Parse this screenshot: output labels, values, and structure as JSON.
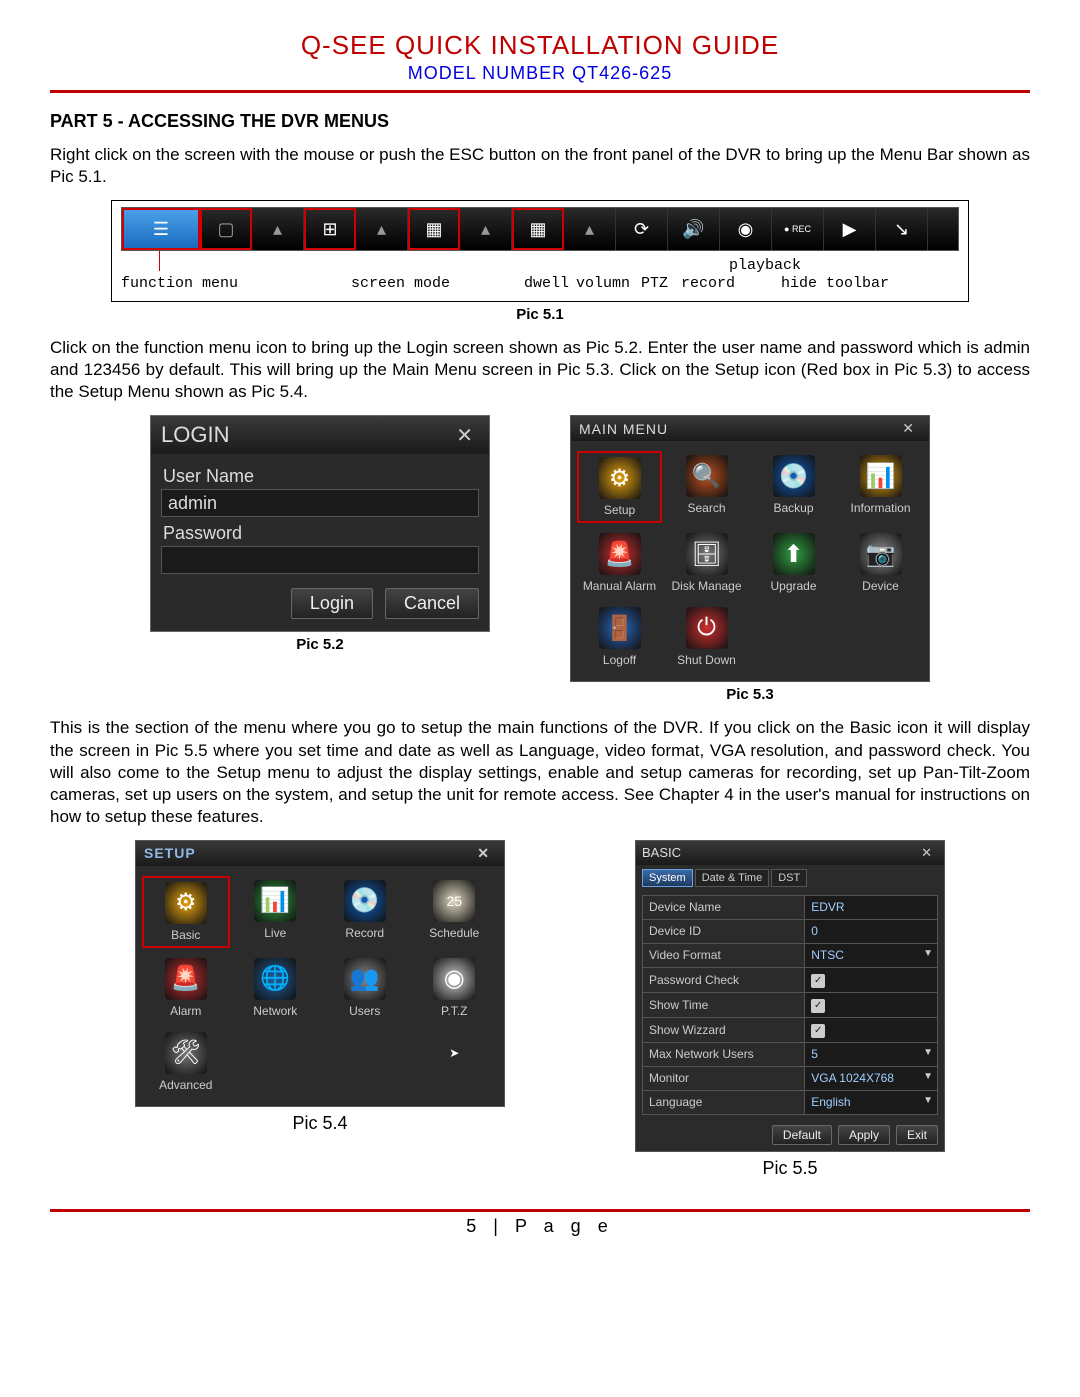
{
  "doc": {
    "title": "Q-SEE QUICK INSTALLATION GUIDE",
    "model": "MODEL NUMBER QT426-625",
    "part": "PART 5 - ACCESSING THE DVR MENUS",
    "para1": "Right click on the screen with the mouse or push the ESC button on the front panel of the DVR to bring up the Menu Bar shown as Pic 5.1.",
    "para2": "Click on the function menu icon to bring up the Login screen shown as Pic 5.2. Enter the user name and password which is admin and 123456 by default. This will bring up the Main Menu screen in Pic 5.3. Click on the Setup icon (Red box in Pic 5.3) to access the Setup Menu shown as Pic 5.4.",
    "para3": "This is the section of the menu where you go to setup the main functions of the DVR. If you click on the Basic icon it will display the screen in Pic 5.5 where you set time and date as well as Language, video format, VGA resolution, and password check. You will also come to the Setup menu to adjust the display settings, enable and setup cameras for recording, set up Pan-Tilt-Zoom cameras, set up users on the system, and setup the unit for remote access. See Chapter 4 in the user's manual for instructions on how to setup these features.",
    "page": "5 | P a g e"
  },
  "pic51": {
    "caption": "Pic 5.1",
    "labels": {
      "function_menu": "function menu",
      "screen_mode": "screen mode",
      "dwell": "dwell",
      "volumn": "volumn",
      "ptz": "PTZ",
      "record": "record",
      "playback": "playback",
      "hide": "hide toolbar"
    },
    "rec": "REC"
  },
  "pic52": {
    "caption": "Pic 5.2",
    "title": "LOGIN",
    "user_label": "User Name",
    "user_value": "admin",
    "pass_label": "Password",
    "pass_value": "",
    "login_btn": "Login",
    "cancel_btn": "Cancel"
  },
  "pic53": {
    "caption": "Pic 5.3",
    "title": "MAIN MENU",
    "items": [
      "Setup",
      "Search",
      "Backup",
      "Information",
      "Manual Alarm",
      "Disk Manage",
      "Upgrade",
      "Device",
      "Logoff",
      "Shut Down"
    ]
  },
  "pic54": {
    "caption": "Pic 5.4",
    "title": "SETUP",
    "items": [
      "Basic",
      "Live",
      "Record",
      "Schedule",
      "Alarm",
      "Network",
      "Users",
      "P.T.Z",
      "Advanced"
    ]
  },
  "pic55": {
    "caption": "Pic 5.5",
    "title": "BASIC",
    "tabs": [
      "System",
      "Date & Time",
      "DST"
    ],
    "rows": [
      {
        "label": "Device Name",
        "value": "EDVR",
        "type": "text"
      },
      {
        "label": "Device ID",
        "value": "0",
        "type": "text"
      },
      {
        "label": "Video Format",
        "value": "NTSC",
        "type": "dropdown"
      },
      {
        "label": "Password Check",
        "value": "✓",
        "type": "check"
      },
      {
        "label": "Show Time",
        "value": "✓",
        "type": "check"
      },
      {
        "label": "Show Wizzard",
        "value": "✓",
        "type": "check"
      },
      {
        "label": "Max Network Users",
        "value": "5",
        "type": "dropdown"
      },
      {
        "label": "Monitor",
        "value": "VGA 1024X768",
        "type": "dropdown"
      },
      {
        "label": "Language",
        "value": "English",
        "type": "dropdown"
      }
    ],
    "buttons": [
      "Default",
      "Apply",
      "Exit"
    ]
  }
}
